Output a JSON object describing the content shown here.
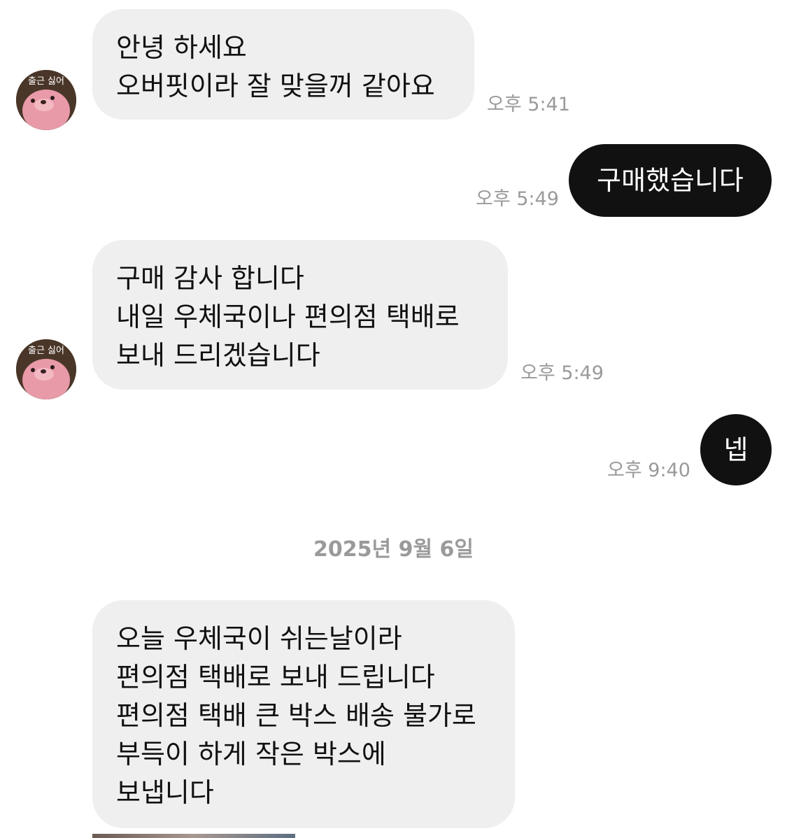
{
  "colors": {
    "incoming_bubble": "#efefef",
    "outgoing_bubble": "#111111",
    "timestamp": "#9a9a9a"
  },
  "avatar_caption": "출근 싫어",
  "messages": [
    {
      "direction": "incoming",
      "text": "안녕 하세요\n오버핏이라 잘 맞을꺼 같아요",
      "time": "오후 5:41"
    },
    {
      "direction": "outgoing",
      "text": "구매했습니다",
      "time": "오후 5:49"
    },
    {
      "direction": "incoming",
      "text": "구매 감사 합니다\n내일 우체국이나 편의점 택배로\n보내 드리겠습니다",
      "time": "오후 5:49"
    },
    {
      "direction": "outgoing",
      "text": "넵",
      "time": "오후 9:40"
    },
    {
      "direction": "incoming",
      "text": "오늘 우체국이 쉬는날이라\n편의점 택배로 보내 드립니다\n편의점 택배 큰 박스 배송 불가로\n부득이 하게 작은 박스에\n보냅니다",
      "time": ""
    }
  ],
  "date_separator": "2025년 9월 6일"
}
